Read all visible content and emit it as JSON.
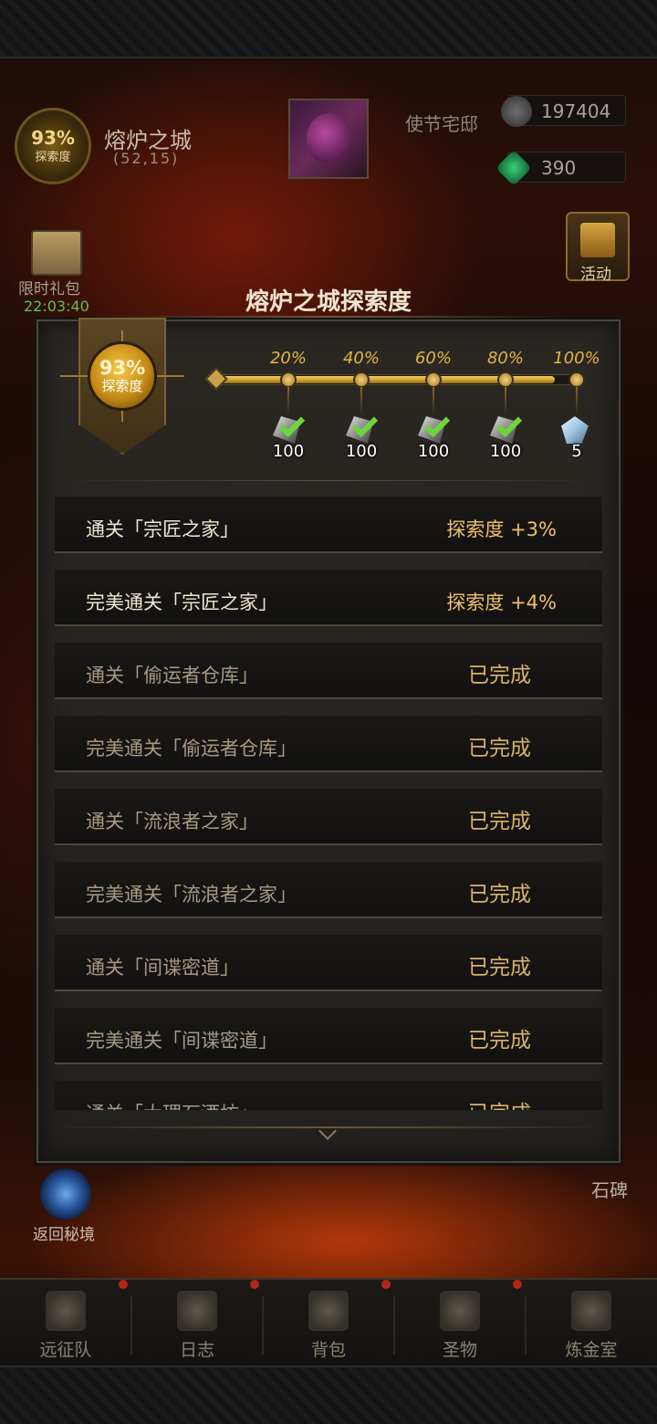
{
  "hud": {
    "explore_pct": "93%",
    "explore_label": "探索度",
    "city_name": "熔炉之城",
    "coords": "(52,15)",
    "mansion_label": "使节宅邸",
    "resource1": "197404",
    "resource2": "390",
    "gift_label": "限时礼包",
    "gift_timer": "22:03:40",
    "activity_label": "活动"
  },
  "dialog": {
    "title": "熔炉之城探索度",
    "badge_pct": "93%",
    "badge_label": "探索度",
    "progress_percent": 93,
    "milestones": [
      {
        "label": "20%",
        "reward_icon": "ore-icon",
        "count": "100",
        "claimed": true
      },
      {
        "label": "40%",
        "reward_icon": "ore-icon",
        "count": "100",
        "claimed": true
      },
      {
        "label": "60%",
        "reward_icon": "ore-icon",
        "count": "100",
        "claimed": true
      },
      {
        "label": "80%",
        "reward_icon": "ore-icon",
        "count": "100",
        "claimed": true
      },
      {
        "label": "100%",
        "reward_icon": "crystal-icon",
        "count": "5",
        "claimed": false
      }
    ],
    "tasks": [
      {
        "name": "通关「宗匠之家」",
        "reward": "探索度 +3%",
        "status": "active"
      },
      {
        "name": "完美通关「宗匠之家」",
        "reward": "探索度 +4%",
        "status": "active"
      },
      {
        "name": "通关「偷运者仓库」",
        "reward": "已完成",
        "status": "done"
      },
      {
        "name": "完美通关「偷运者仓库」",
        "reward": "已完成",
        "status": "done"
      },
      {
        "name": "通关「流浪者之家」",
        "reward": "已完成",
        "status": "done"
      },
      {
        "name": "完美通关「流浪者之家」",
        "reward": "已完成",
        "status": "done"
      },
      {
        "name": "通关「间谍密道」",
        "reward": "已完成",
        "status": "done"
      },
      {
        "name": "完美通关「间谍密道」",
        "reward": "已完成",
        "status": "done"
      },
      {
        "name": "通关「大理石酒坊」",
        "reward": "已完成",
        "status": "done"
      }
    ]
  },
  "portal_label": "返回秘境",
  "stele_label": "石碑",
  "nav": [
    {
      "label": "远征队",
      "icon": "horned-helmet-icon"
    },
    {
      "label": "日志",
      "icon": "scroll-icon"
    },
    {
      "label": "背包",
      "icon": "bag-icon"
    },
    {
      "label": "圣物",
      "icon": "chalice-icon"
    },
    {
      "label": "炼金室",
      "icon": "alchemy-icon"
    }
  ]
}
